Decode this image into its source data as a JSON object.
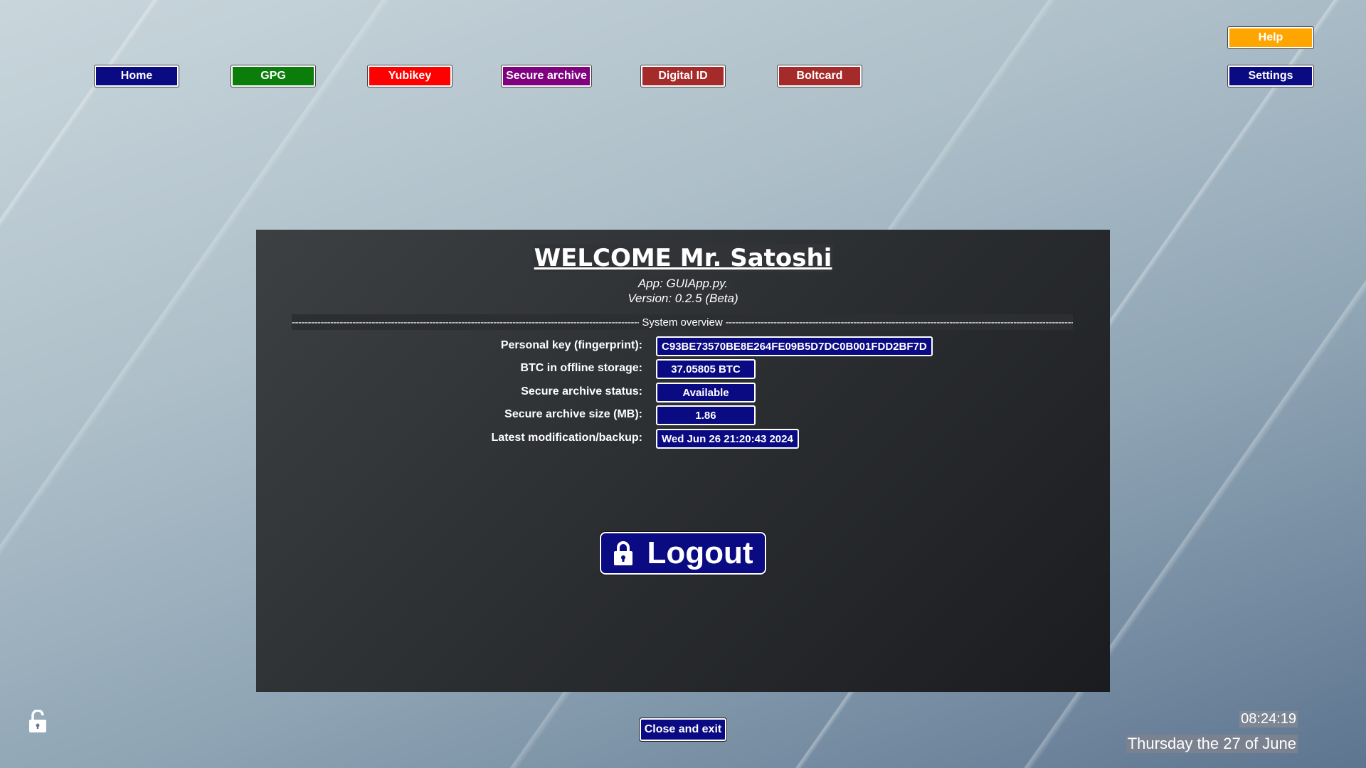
{
  "nav": {
    "home": {
      "label": "Home",
      "color": "#0a0a82"
    },
    "gpg": {
      "label": "GPG",
      "color": "#0a7d0a"
    },
    "yubikey": {
      "label": "Yubikey",
      "color": "#ff0000"
    },
    "secure_archive": {
      "label": "Secure archive",
      "color": "#800080"
    },
    "digital_id": {
      "label": "Digital ID",
      "color": "#a52a2a"
    },
    "boltcard": {
      "label": "Boltcard",
      "color": "#a52a2a"
    },
    "help": {
      "label": "Help",
      "color": "#ffa500"
    },
    "settings": {
      "label": "Settings",
      "color": "#0a0a82"
    }
  },
  "welcome": {
    "title": "WELCOME  Mr. Satoshi",
    "app": "App: GUIApp.py.",
    "version": "Version: 0.2.5 (Beta)"
  },
  "overview": {
    "section_label": "System overview",
    "rows": [
      {
        "label": "Personal key (fingerprint):",
        "value": "C93BE73570BE8E264FE09B5D7DC0B001FDD2BF7D"
      },
      {
        "label": "BTC in offline storage:",
        "value": "37.05805 BTC"
      },
      {
        "label": "Secure archive status:",
        "value": "Available"
      },
      {
        "label": "Secure archive size (MB):",
        "value": "1.86"
      },
      {
        "label": "Latest modification/backup:",
        "value": "Wed Jun 26 21:20:43 2024"
      }
    ]
  },
  "logout": {
    "label": "Logout",
    "icon": "lock-icon"
  },
  "footer": {
    "close_label": "Close and exit",
    "time": "08:24:19",
    "date": "Thursday the 27 of June",
    "corner_icon": "unlock-icon"
  }
}
